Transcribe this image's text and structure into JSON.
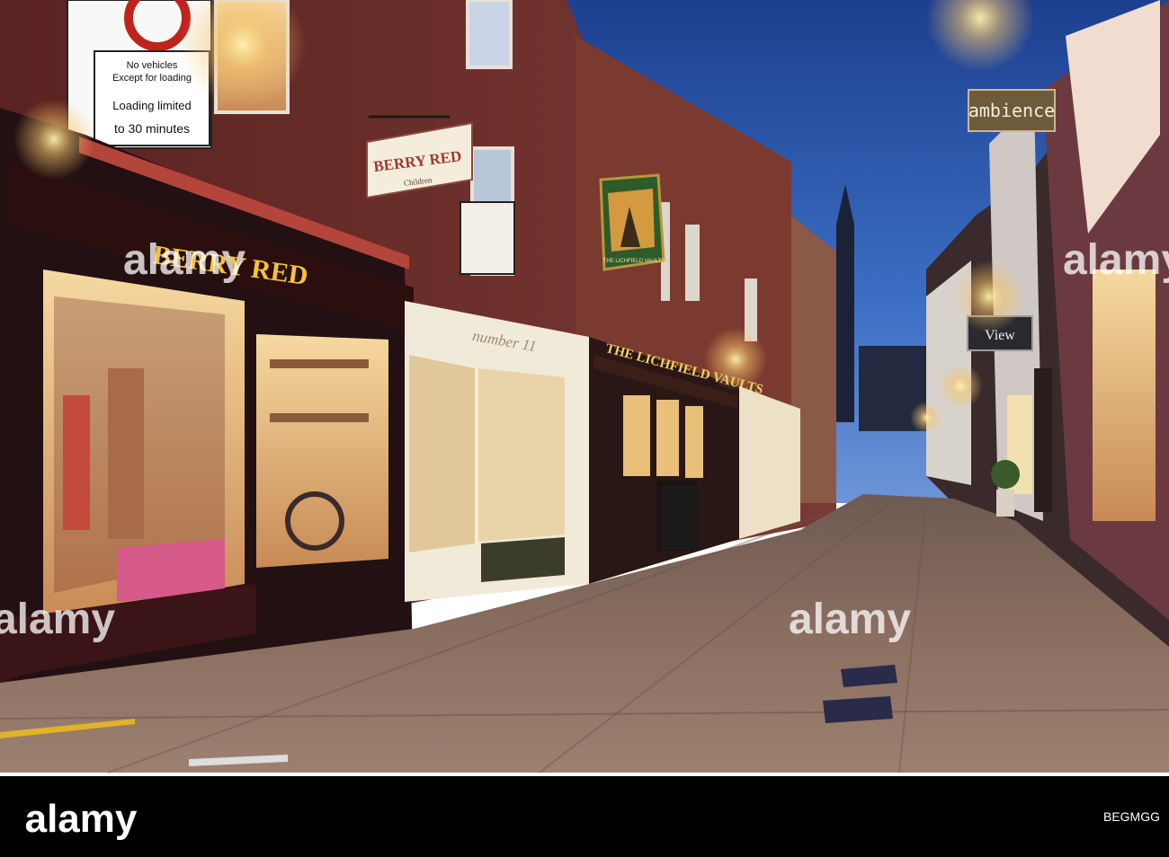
{
  "signs": {
    "traffic_line1": "No vehicles",
    "traffic_line2": "Except for loading",
    "traffic_line3": "Loading limited",
    "traffic_line4": "to 30 minutes",
    "shop_fascia": "BERRY RED",
    "hanging_berry_red": "BERRY RED",
    "hanging_children": "Children",
    "number_fascia": "number 11",
    "pub_fascia": "THE LICHFIELD VAULTS",
    "pub_sign": "THE LICHFIELD VAULTS",
    "ambience": "ambience",
    "view": "View"
  },
  "watermark": {
    "text": "alamy",
    "bottom_right": "BEGMGG"
  },
  "colors": {
    "sky": "#3b6fc4",
    "night_sky_top": "#1e3f8f",
    "brick": "#6e2c2a",
    "warm_light": "#f6c46a",
    "pavement": "#8a6e60",
    "shop_fascia": "#2a0f0e",
    "gold_lettering": "#f5c23a"
  }
}
